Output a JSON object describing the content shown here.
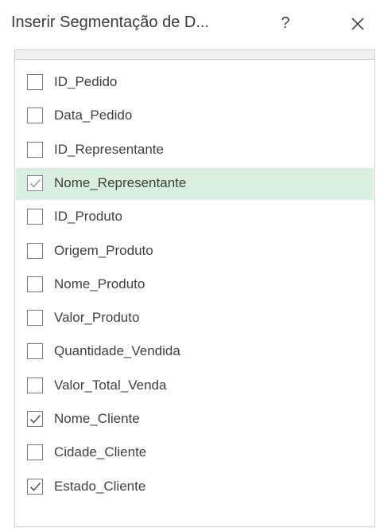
{
  "dialog": {
    "title": "Inserir Segmentação de D...",
    "help_label": "?",
    "close_label": "×"
  },
  "fields": [
    {
      "label": "ID_Pedido",
      "checked": false,
      "selected": false
    },
    {
      "label": "Data_Pedido",
      "checked": false,
      "selected": false
    },
    {
      "label": "ID_Representante",
      "checked": false,
      "selected": false
    },
    {
      "label": "Nome_Representante",
      "checked": true,
      "selected": true
    },
    {
      "label": "ID_Produto",
      "checked": false,
      "selected": false
    },
    {
      "label": "Origem_Produto",
      "checked": false,
      "selected": false
    },
    {
      "label": "Nome_Produto",
      "checked": false,
      "selected": false
    },
    {
      "label": "Valor_Produto",
      "checked": false,
      "selected": false
    },
    {
      "label": "Quantidade_Vendida",
      "checked": false,
      "selected": false
    },
    {
      "label": "Valor_Total_Venda",
      "checked": false,
      "selected": false
    },
    {
      "label": "Nome_Cliente",
      "checked": true,
      "selected": false
    },
    {
      "label": "Cidade_Cliente",
      "checked": false,
      "selected": false
    },
    {
      "label": "Estado_Cliente",
      "checked": true,
      "selected": false
    }
  ],
  "colors": {
    "selected_row": "#d8eee0",
    "checkmark": "#555555",
    "checkmark_selected": "#9a9a9a"
  }
}
